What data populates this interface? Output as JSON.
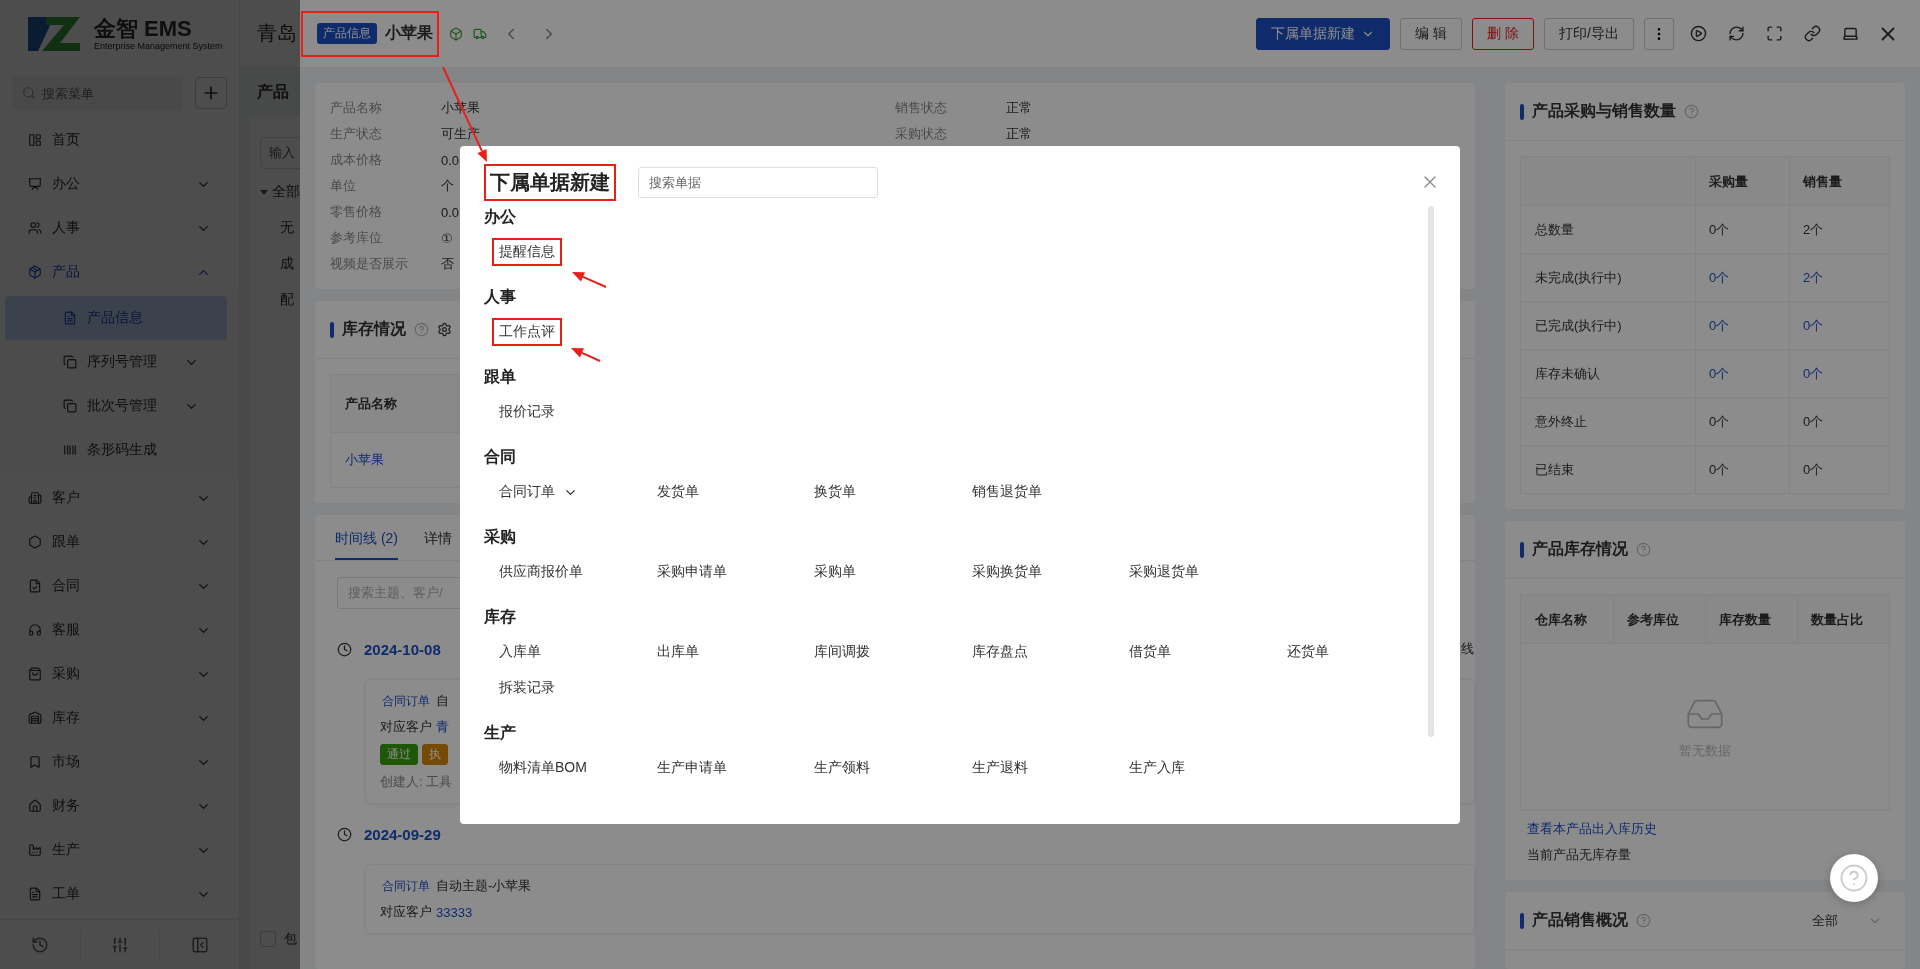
{
  "sidebar": {
    "logo": {
      "brand": "金智 EMS",
      "tagline": "Enterprise Management System"
    },
    "search": {
      "placeholder": "搜索菜单"
    },
    "items": [
      {
        "label": "首页",
        "selected": false
      },
      {
        "label": "办公",
        "selected": false,
        "expanded": false
      },
      {
        "label": "人事",
        "selected": false,
        "expanded": false
      },
      {
        "label": "产品",
        "selected": false,
        "expanded": true,
        "children": [
          {
            "label": "产品信息",
            "selected": true
          },
          {
            "label": "序列号管理",
            "selected": false,
            "expanded": false
          },
          {
            "label": "批次号管理",
            "selected": false,
            "expanded": false
          },
          {
            "label": "条形码生成",
            "selected": false
          }
        ]
      },
      {
        "label": "客户",
        "selected": false,
        "expanded": false
      },
      {
        "label": "跟单",
        "selected": false,
        "expanded": false
      },
      {
        "label": "合同",
        "selected": false,
        "expanded": false
      },
      {
        "label": "客服",
        "selected": false,
        "expanded": false
      },
      {
        "label": "采购",
        "selected": false,
        "expanded": false
      },
      {
        "label": "库存",
        "selected": false,
        "expanded": false
      },
      {
        "label": "市场",
        "selected": false,
        "expanded": false
      },
      {
        "label": "财务",
        "selected": false,
        "expanded": false
      },
      {
        "label": "生产",
        "selected": false,
        "expanded": false
      },
      {
        "label": "工单",
        "selected": false,
        "expanded": false
      }
    ]
  },
  "page": {
    "header_title": "青岛",
    "title": "产品",
    "filter": {
      "placeholder": "输入"
    },
    "tree": [
      {
        "label": "全部",
        "expanded": true,
        "children": [
          {
            "label": "无"
          },
          {
            "label": "成"
          },
          {
            "label": "配"
          }
        ]
      }
    ],
    "checkbox": {
      "label": "包",
      "checked": false
    }
  },
  "drawer": {
    "header": {
      "tag": "产品信息",
      "name": "小苹果",
      "highlighted": true,
      "actions": [
        {
          "label": "下属单据新建",
          "kind": "primary"
        },
        {
          "label": "编 辑",
          "kind": "default"
        },
        {
          "label": "删 除",
          "kind": "danger"
        },
        {
          "label": "打印/导出",
          "kind": "default"
        }
      ]
    },
    "info": {
      "left": [
        {
          "label": "产品名称",
          "value": "小苹果"
        },
        {
          "label": "生产状态",
          "value": "可生产"
        },
        {
          "label": "成本价格",
          "value": "0.0"
        },
        {
          "label": "单位",
          "value": "个"
        },
        {
          "label": "零售价格",
          "value": "0.0"
        },
        {
          "label": "参考库位",
          "value": "①"
        },
        {
          "label": "视频是否展示",
          "value": "否"
        }
      ],
      "right": [
        {
          "label": "销售状态",
          "value": "正常"
        },
        {
          "label": "采购状态",
          "value": "正常"
        }
      ]
    },
    "stock": {
      "title": "库存情况",
      "columns": [
        "产品名称"
      ],
      "rows": [
        [
          "小苹果"
        ]
      ]
    },
    "timeline": {
      "tabs": [
        {
          "label": "时间线 (2)",
          "selected": true
        },
        {
          "label": "详情",
          "selected": false
        }
      ],
      "search": {
        "placeholder": "搜索主题、客户/"
      },
      "side_text": "线",
      "entries": [
        {
          "date": "2024-10-08",
          "type": "合同订单",
          "subject": "自",
          "customer_label": "对应客户",
          "customer": "青",
          "tags": [
            {
              "label": "通过",
              "color": "#1f5707"
            },
            {
              "label": "执",
              "color": "#754b03"
            }
          ],
          "creator": "创建人: 工具"
        },
        {
          "date": "2024-09-29",
          "type": "合同订单",
          "subject": "自动主题-小苹果",
          "customer_label": "对应客户",
          "customer": "33333"
        }
      ]
    },
    "quantities": {
      "title": "产品采购与销售数量",
      "columns": [
        "采购量",
        "销售量"
      ],
      "rows": [
        {
          "label": "总数量",
          "cells": [
            {
              "text": "0个",
              "link": false
            },
            {
              "text": "2个",
              "link": false
            }
          ]
        },
        {
          "label": "未完成(执行中)",
          "cells": [
            {
              "text": "0个",
              "link": true
            },
            {
              "text": "2个",
              "link": true
            }
          ]
        },
        {
          "label": "已完成(执行中)",
          "cells": [
            {
              "text": "0个",
              "link": true
            },
            {
              "text": "0个",
              "link": true
            }
          ]
        },
        {
          "label": "库存未确认",
          "cells": [
            {
              "text": "0个",
              "link": true
            },
            {
              "text": "0个",
              "link": true
            }
          ]
        },
        {
          "label": "意外终止",
          "cells": [
            {
              "text": "0个",
              "link": false
            },
            {
              "text": "0个",
              "link": false
            }
          ]
        },
        {
          "label": "已结束",
          "cells": [
            {
              "text": "0个",
              "link": false
            },
            {
              "text": "0个",
              "link": false
            }
          ]
        }
      ]
    },
    "inventory": {
      "title": "产品库存情况",
      "columns": [
        "仓库名称",
        "参考库位",
        "库存数量",
        "数量占比"
      ],
      "empty": "暂无数据",
      "history_link": "查看本产品出入库历史",
      "note": "当前产品无库存量"
    },
    "sales": {
      "title": "产品销售概况",
      "range": "全部"
    }
  },
  "modal": {
    "title": "下属单据新建",
    "highlighted": true,
    "search": {
      "placeholder": "搜索单据"
    },
    "sections": [
      {
        "title": "办公",
        "items": [
          {
            "label": "提醒信息",
            "kind": "link",
            "highlighted": true
          }
        ]
      },
      {
        "title": "人事",
        "items": [
          {
            "label": "工作点评",
            "kind": "link",
            "highlighted": true
          }
        ]
      },
      {
        "title": "跟单",
        "items": [
          {
            "label": "报价记录",
            "kind": "link",
            "highlighted": false
          }
        ]
      },
      {
        "title": "合同",
        "items": [
          {
            "label": "合同订单",
            "kind": "dropdown",
            "highlighted": false
          },
          {
            "label": "发货单",
            "kind": "link",
            "highlighted": false
          },
          {
            "label": "换货单",
            "kind": "link",
            "highlighted": false
          },
          {
            "label": "销售退货单",
            "kind": "link",
            "highlighted": false
          }
        ]
      },
      {
        "title": "采购",
        "items": [
          {
            "label": "供应商报价单",
            "kind": "link",
            "highlighted": false
          },
          {
            "label": "采购申请单",
            "kind": "link",
            "highlighted": false
          },
          {
            "label": "采购单",
            "kind": "link",
            "highlighted": false
          },
          {
            "label": "采购换货单",
            "kind": "link",
            "highlighted": false
          },
          {
            "label": "采购退货单",
            "kind": "link",
            "highlighted": false
          }
        ]
      },
      {
        "title": "库存",
        "items": [
          {
            "label": "入库单",
            "kind": "link",
            "highlighted": false
          },
          {
            "label": "出库单",
            "kind": "link",
            "highlighted": false
          },
          {
            "label": "库间调拨",
            "kind": "link",
            "highlighted": false
          },
          {
            "label": "库存盘点",
            "kind": "link",
            "highlighted": false
          },
          {
            "label": "借货单",
            "kind": "link",
            "highlighted": false
          },
          {
            "label": "还货单",
            "kind": "link",
            "highlighted": false
          },
          {
            "label": "拆装记录",
            "kind": "link",
            "highlighted": false
          }
        ]
      },
      {
        "title": "生产",
        "items": [
          {
            "label": "物料清单BOM",
            "kind": "link",
            "highlighted": false
          },
          {
            "label": "生产申请单",
            "kind": "link",
            "highlighted": false
          },
          {
            "label": "生产领料",
            "kind": "link",
            "highlighted": false
          },
          {
            "label": "生产退料",
            "kind": "link",
            "highlighted": false
          },
          {
            "label": "生产入库",
            "kind": "link",
            "highlighted": false
          }
        ]
      }
    ]
  }
}
